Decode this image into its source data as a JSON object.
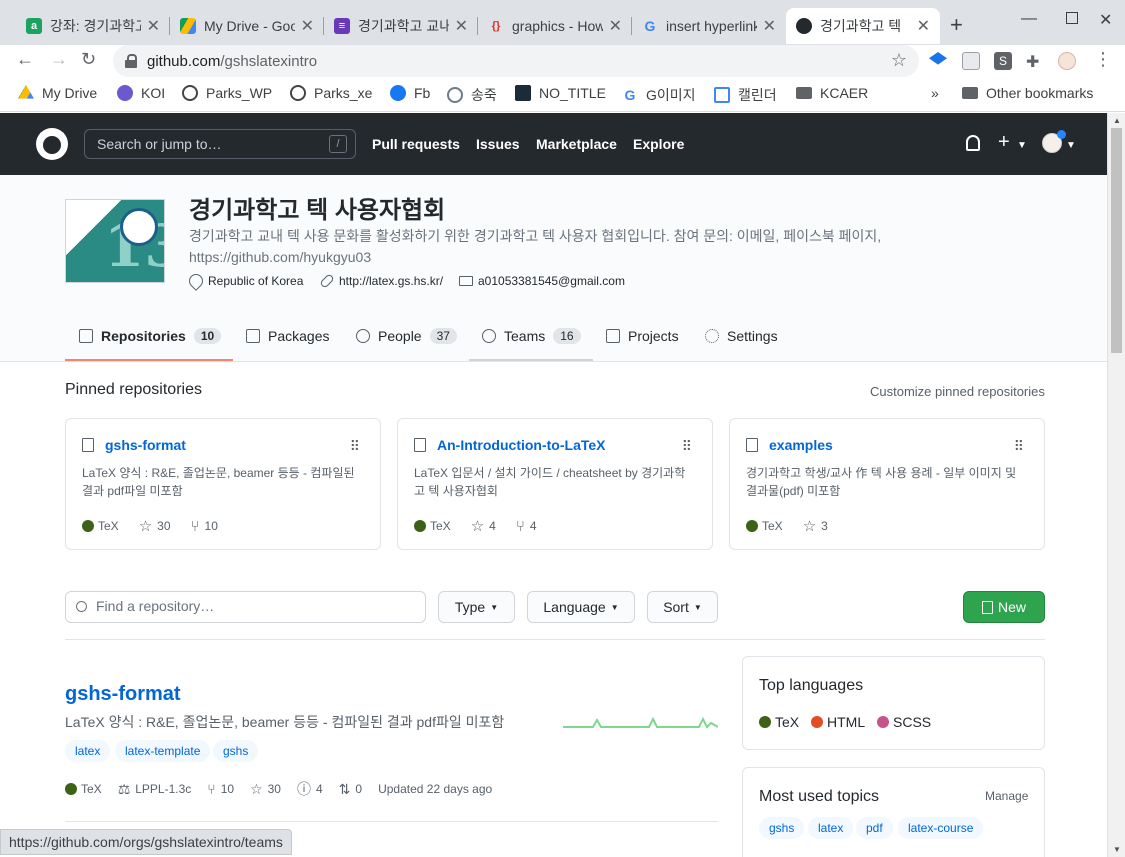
{
  "browser": {
    "tabs": [
      {
        "label": "강좌: 경기과학고",
        "icon": "moodle-icon",
        "color": "#1aa260"
      },
      {
        "label": "My Drive - Google",
        "icon": "google-drive-icon",
        "color": "#fbbc04"
      },
      {
        "label": "경기과학고 교내",
        "icon": "google-forms-icon",
        "color": "#673ab7"
      },
      {
        "label": "graphics - How",
        "icon": "overleaf-braces-icon",
        "color": "#d93025"
      },
      {
        "label": "insert hyperlink",
        "icon": "google-icon",
        "color": "#4285f4"
      },
      {
        "label": "경기과학고 텍",
        "icon": "github-icon",
        "color": "#24292e"
      }
    ],
    "url_host": "github.com",
    "url_path": "/gshslatexintro",
    "bookmarks": [
      {
        "label": "My Drive",
        "color": "#34a853"
      },
      {
        "label": "KOI",
        "color": "#6a5acd"
      },
      {
        "label": "Parks_WP",
        "color": "#444"
      },
      {
        "label": "Parks_xe",
        "color": "#444"
      },
      {
        "label": "Fb",
        "color": "#1877f2"
      },
      {
        "label": "송죽",
        "color": "#6c7a89"
      },
      {
        "label": "NO_TITLE",
        "color": "#1c2a39"
      },
      {
        "label": "G이미지",
        "color": "#4285f4"
      },
      {
        "label": "캘린더",
        "color": "#4285f4"
      },
      {
        "label": "KCAER",
        "color": "#5f6368"
      }
    ],
    "bookmarks_more": "»",
    "other_bookmarks": "Other bookmarks",
    "status_url": "https://github.com/orgs/gshslatexintro/teams"
  },
  "github": {
    "search_placeholder": "Search or jump to…",
    "search_shortcut": "/",
    "nav": [
      "Pull requests",
      "Issues",
      "Marketplace",
      "Explore"
    ]
  },
  "org": {
    "name": "경기과학고 텍 사용자협회",
    "description": "경기과학고 교내 텍 사용 문화를 활성화하기 위한 경기과학고 텍 사용자 협회입니다. 참여 문의: 이메일, 페이스북 페이지,",
    "description_link": "https://github.com/hyukgyu03",
    "location": "Republic of Korea",
    "website": "http://latex.gs.hs.kr/",
    "email": "a01053381545@gmail.com",
    "logo_text": "13",
    "tabs": [
      {
        "label": "Repositories",
        "count": "10"
      },
      {
        "label": "Packages",
        "count": ""
      },
      {
        "label": "People",
        "count": "37"
      },
      {
        "label": "Teams",
        "count": "16"
      },
      {
        "label": "Projects",
        "count": ""
      },
      {
        "label": "Settings",
        "count": ""
      }
    ]
  },
  "pinned": {
    "title": "Pinned repositories",
    "customize": "Customize pinned repositories",
    "repos": [
      {
        "name": "gshs-format",
        "desc": "LaTeX 양식 : R&E, 졸업논문, beamer 등등 - 컴파일된 결과 pdf파일 미포함",
        "lang": "TeX",
        "lang_color": "#3d6117",
        "stars": "30",
        "forks": "10"
      },
      {
        "name": "An-Introduction-to-LaTeX",
        "desc": "LaTeX 입문서 / 설치 가이드 / cheatsheet by 경기과학고 텍 사용자협회",
        "lang": "TeX",
        "lang_color": "#3d6117",
        "stars": "4",
        "forks": "4"
      },
      {
        "name": "examples",
        "desc": "경기과학고 학생/교사 作 텍 사용 용례 - 일부 이미지 및 결과물(pdf) 미포함",
        "lang": "TeX",
        "lang_color": "#3d6117",
        "stars": "3",
        "forks": ""
      }
    ]
  },
  "filters": {
    "find_placeholder": "Find a repository…",
    "type": "Type",
    "language": "Language",
    "sort": "Sort",
    "new": "New"
  },
  "repo_list": [
    {
      "name": "gshs-format",
      "desc": "LaTeX 양식 : R&E, 졸업논문, beamer 등등 - 컴파일된 결과 pdf파일 미포함",
      "topics": [
        "latex",
        "latex-template",
        "gshs"
      ],
      "lang": "TeX",
      "license": "LPPL-1.3c",
      "forks": "10",
      "stars": "30",
      "issues": "4",
      "prs": "0",
      "updated": "Updated 22 days ago"
    }
  ],
  "sidebar": {
    "top_languages_title": "Top languages",
    "languages": [
      {
        "name": "TeX",
        "color": "#3d6117"
      },
      {
        "name": "HTML",
        "color": "#e34c26"
      },
      {
        "name": "SCSS",
        "color": "#c6538c"
      }
    ],
    "topics_title": "Most used topics",
    "manage": "Manage",
    "topics": [
      "gshs",
      "latex",
      "pdf",
      "latex-course"
    ]
  }
}
